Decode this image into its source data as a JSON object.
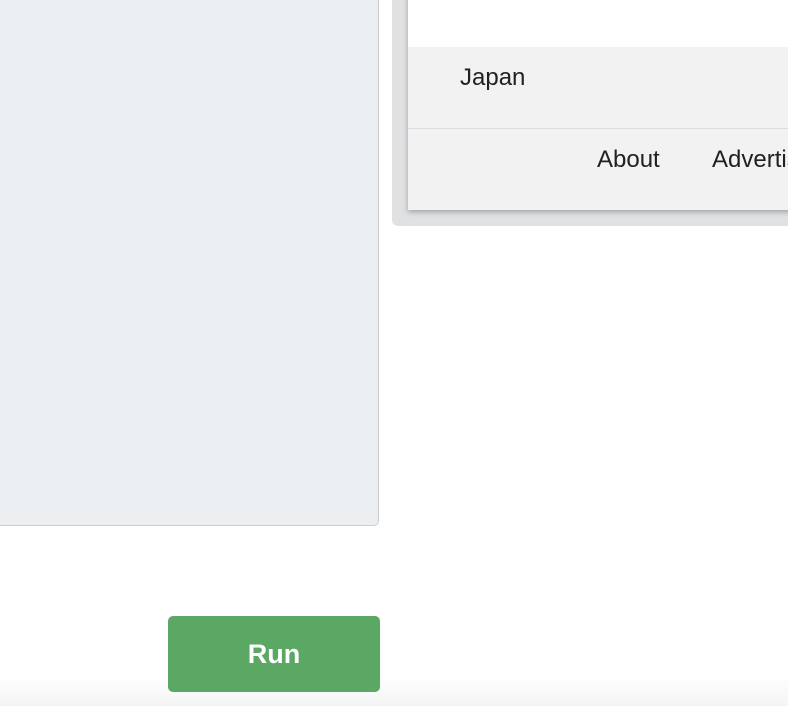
{
  "preview": {
    "footer": {
      "country": "Japan",
      "links": [
        {
          "label": "About"
        },
        {
          "label": "Advertising"
        }
      ]
    }
  },
  "actions": {
    "run_label": "Run"
  },
  "colors": {
    "run_button": "#5ba864",
    "editor_background": "#ebeff1",
    "footer_background": "#f2f2f2"
  }
}
